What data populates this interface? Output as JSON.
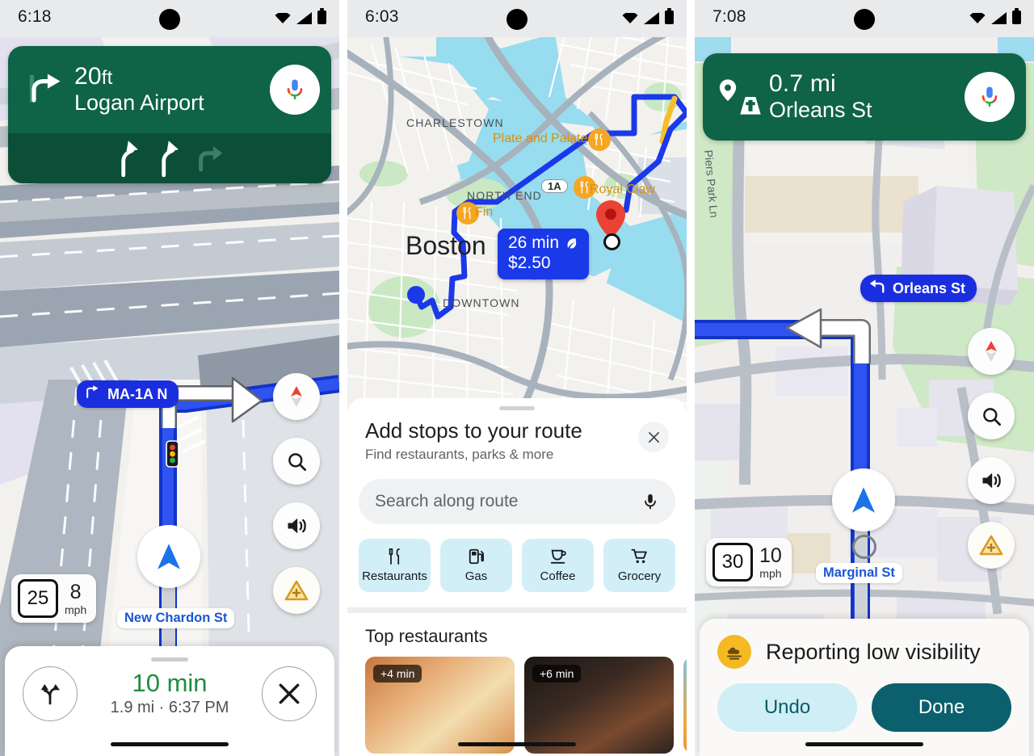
{
  "panels": [
    {
      "id": "navigation-turn",
      "status_bar": {
        "time": "6:18",
        "icons": [
          "wifi-icon",
          "cellular-icon",
          "battery-icon"
        ]
      },
      "nav_banner": {
        "maneuver_icon": "turn-right-icon",
        "distance": "20",
        "distance_unit": "ft",
        "street": "Logan Airport",
        "mic_icon": "google-assistant-mic-icon",
        "lanes": [
          "lane-slight-left-active",
          "lane-slight-left-active",
          "lane-turn-right-inactive"
        ]
      },
      "map": {
        "route_shield": {
          "icon": "turn-right-icon",
          "label": "MA-1A N"
        },
        "street_label": "New Chardon St",
        "traffic_light_icon": "traffic-signal-icon",
        "puck_icon": "navigation-arrow-icon"
      },
      "speed": {
        "limit": "25",
        "current": "8",
        "unit": "mph"
      },
      "map_buttons": [
        {
          "name": "compass-button",
          "icon": "compass-icon"
        },
        {
          "name": "search-button",
          "icon": "search-icon"
        },
        {
          "name": "sound-button",
          "icon": "volume-icon"
        },
        {
          "name": "report-button",
          "icon": "report-incident-icon"
        }
      ],
      "bottom_sheet": {
        "routes_icon": "alternate-routes-icon",
        "eta_time": "10 min",
        "eta_sub": "1.9 mi  ·  6:37 PM",
        "close_icon": "close-icon"
      }
    },
    {
      "id": "add-stops",
      "status_bar": {
        "time": "6:03"
      },
      "map": {
        "place_labels": [
          "CHARLESTOWN",
          "NORTH END",
          "DOWNTOWN"
        ],
        "city_label": "Boston",
        "pois": [
          {
            "name": "Plate and Palate",
            "icon": "restaurant-icon"
          },
          {
            "name": "Royal Claw",
            "icon": "restaurant-icon"
          },
          {
            "name": "Fin",
            "icon": "restaurant-icon"
          }
        ],
        "highway_shield": "1A",
        "route_badge": {
          "duration": "26 min",
          "eco_icon": "eco-leaf-icon",
          "price": "$2.50"
        },
        "destination_icon": "destination-pin-icon",
        "origin_icon": "origin-dot-icon"
      },
      "sheet": {
        "title": "Add stops to your route",
        "subtitle": "Find restaurants, parks & more",
        "close_icon": "close-icon",
        "search": {
          "placeholder": "Search along route",
          "mic_icon": "mic-icon"
        },
        "chips": [
          {
            "label": "Restaurants",
            "icon": "restaurant-icon"
          },
          {
            "label": "Gas",
            "icon": "gas-pump-icon"
          },
          {
            "label": "Coffee",
            "icon": "coffee-cup-icon"
          },
          {
            "label": "Grocery",
            "icon": "shopping-cart-icon"
          }
        ],
        "section_title": "Top restaurants",
        "cards": [
          {
            "badge": "+4 min"
          },
          {
            "badge": "+6 min"
          },
          {
            "badge": ""
          }
        ]
      }
    },
    {
      "id": "report-low-visibility",
      "status_bar": {
        "time": "7:08"
      },
      "nav_banner": {
        "maneuver_icon": "destination-road-icon",
        "distance": "0.7 mi",
        "street": "Orleans St",
        "mic_icon": "google-assistant-mic-icon"
      },
      "map": {
        "callout": {
          "icon": "turn-left-icon",
          "label": "Orleans St"
        },
        "street_label": "Marginal St",
        "road_label": "Piers Park Ln",
        "puck_icon": "navigation-arrow-icon"
      },
      "speed": {
        "limit": "30",
        "current": "10",
        "unit": "mph"
      },
      "map_buttons": [
        {
          "name": "compass-button",
          "icon": "compass-icon"
        },
        {
          "name": "search-button",
          "icon": "search-icon"
        },
        {
          "name": "sound-button",
          "icon": "volume-icon"
        },
        {
          "name": "report-button",
          "icon": "report-incident-icon"
        }
      ],
      "toast": {
        "icon": "fog-low-visibility-icon",
        "title": "Reporting low visibility",
        "undo_label": "Undo",
        "done_label": "Done"
      }
    }
  ],
  "colors": {
    "nav_green": "#0f6347",
    "nav_green_dark": "#0b4f38",
    "route_blue": "#1a2ee0",
    "eta_green": "#1e8e3e",
    "chip_cyan": "#d2eff7",
    "done_teal": "#0c606d",
    "report_yellow": "#f5b924",
    "poi_orange": "#f5a623"
  }
}
